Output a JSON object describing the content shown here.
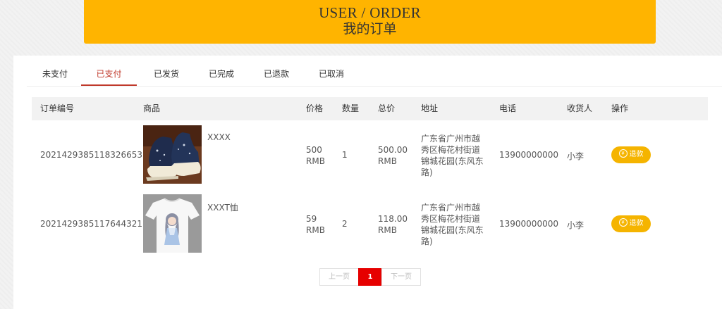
{
  "banner": {
    "title_en": "USER / ORDER",
    "title_cn": "我的订单"
  },
  "tabs": [
    {
      "label": "未支付"
    },
    {
      "label": "已支付",
      "active": true
    },
    {
      "label": "已发货"
    },
    {
      "label": "已完成"
    },
    {
      "label": "已退款"
    },
    {
      "label": "已取消"
    }
  ],
  "table": {
    "headers": {
      "order_no": "订单编号",
      "product": "商品",
      "price": "价格",
      "qty": "数量",
      "total": "总价",
      "address": "地址",
      "phone": "电话",
      "receiver": "收货人",
      "action": "操作"
    },
    "rows": [
      {
        "order_no": "2021429385118326653",
        "product_name": "XXXX",
        "product_image": "sneaker-image",
        "price": "500\nRMB",
        "qty": "1",
        "total": "500.00\nRMB",
        "address": "广东省广州市越秀区梅花村街道锦城花园(东风东路)",
        "phone": "13900000000",
        "receiver": "小李",
        "action": "退款"
      },
      {
        "order_no": "2021429385117644321",
        "product_name": "XXXT恤",
        "product_image": "tshirt-image",
        "price": "59\nRMB",
        "qty": "2",
        "total": "118.00\nRMB",
        "address": "广东省广州市越秀区梅花村街道锦城花园(东风东路)",
        "phone": "13900000000",
        "receiver": "小李",
        "action": "退款"
      }
    ]
  },
  "pagination": {
    "prev": "上一页",
    "current": "1",
    "next": "下一页"
  },
  "colors": {
    "banner": "#FFB400",
    "active_tab": "#c0392b",
    "refund_button": "#F5B400",
    "current_page": "#e60000"
  }
}
